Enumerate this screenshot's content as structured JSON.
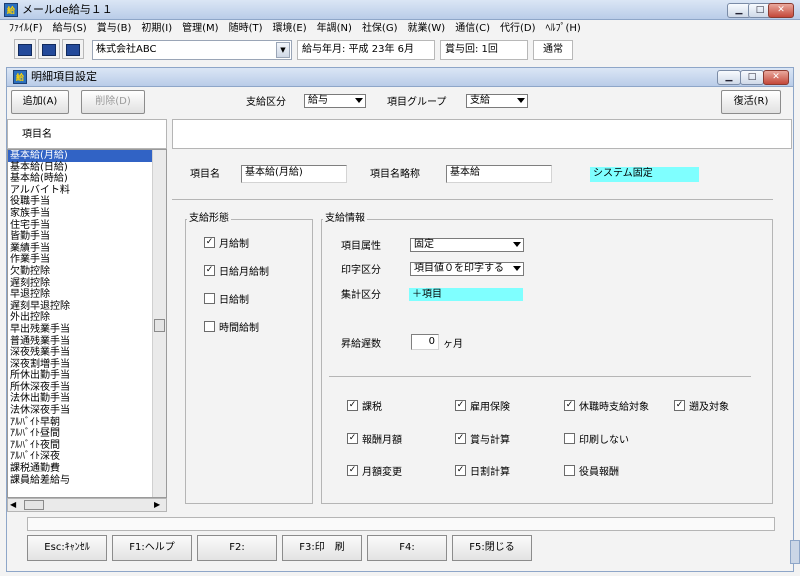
{
  "app": {
    "title": "メールde給与１１",
    "icon_text": "給"
  },
  "menu": [
    "ﾌｧｲﾙ(F)",
    "給与(S)",
    "賞与(B)",
    "初期(I)",
    "管理(M)",
    "随時(T)",
    "環境(E)",
    "年調(N)",
    "社保(G)",
    "就業(W)",
    "通信(C)",
    "代行(D)",
    "ﾍﾙﾌﾟ(H)"
  ],
  "toolbar": {
    "company": "株式会社ABC",
    "pay_month": "給与年月: 平成 23年  6月",
    "bonus_count": "賞与回: 1回",
    "mode": "通常"
  },
  "window": {
    "title": "明細項目設定",
    "icon_text": "給"
  },
  "buttons": {
    "add": "追加(A)",
    "delete": "削除(D)",
    "restore": "復活(R)"
  },
  "filters": {
    "pay_type_label": "支給区分",
    "pay_type_value": "給与",
    "item_group_label": "項目グループ",
    "item_group_value": "支給"
  },
  "list": {
    "header": "項目名",
    "items": [
      "基本給(月給)",
      "基本給(日給)",
      "基本給(時給)",
      "アルバイト料",
      "役職手当",
      "家族手当",
      "住宅手当",
      "皆勤手当",
      "業績手当",
      "作業手当",
      "欠勤控除",
      "遅刻控除",
      "早退控除",
      "遅刻早退控除",
      "外出控除",
      "早出残業手当",
      "普通残業手当",
      "深夜残業手当",
      "深夜割増手当",
      "所休出勤手当",
      "所休深夜手当",
      "法休出勤手当",
      "法休深夜手当",
      "ｱﾙﾊﾞｲﾄ早朝",
      "ｱﾙﾊﾞｲﾄ昼間",
      "ｱﾙﾊﾞｲﾄ夜間",
      "ｱﾙﾊﾞｲﾄ深夜",
      "課税通勤費",
      "課員給差給与"
    ],
    "selected_index": 0
  },
  "detail": {
    "item_name_label": "項目名",
    "item_name_value": "基本給(月給)",
    "short_name_label": "項目名略称",
    "short_name_value": "基本給",
    "system_fixed": "システム固定"
  },
  "pay_form": {
    "title": "支給形態",
    "options": [
      {
        "label": "月給制",
        "checked": true
      },
      {
        "label": "日給月給制",
        "checked": true
      },
      {
        "label": "日給制",
        "checked": false
      },
      {
        "label": "時間給制",
        "checked": false
      }
    ]
  },
  "pay_info": {
    "title": "支給情報",
    "attr_label": "項目属性",
    "attr_value": "固定",
    "print_label": "印字区分",
    "print_value": "項目値０を印字する",
    "sum_label": "集計区分",
    "sum_value": "＋項目",
    "delay_label": "昇給遅数",
    "delay_value": "0",
    "delay_unit": "ヶ月",
    "checks": [
      {
        "label": "課税",
        "checked": true
      },
      {
        "label": "雇用保険",
        "checked": true
      },
      {
        "label": "休職時支給対象",
        "checked": true
      },
      {
        "label": "遡及対象",
        "checked": true
      },
      {
        "label": "報酬月額",
        "checked": true
      },
      {
        "label": "賞与計算",
        "checked": true
      },
      {
        "label": "印刷しない",
        "checked": false
      },
      {
        "label": "月額変更",
        "checked": true
      },
      {
        "label": "日割計算",
        "checked": true
      },
      {
        "label": "役員報酬",
        "checked": false
      }
    ]
  },
  "fkeys": [
    "Esc:ｷｬﾝｾﾙ",
    "F1:ヘルプ",
    "F2:",
    "F3:印　刷",
    "F4:",
    "F5:閉じる"
  ]
}
